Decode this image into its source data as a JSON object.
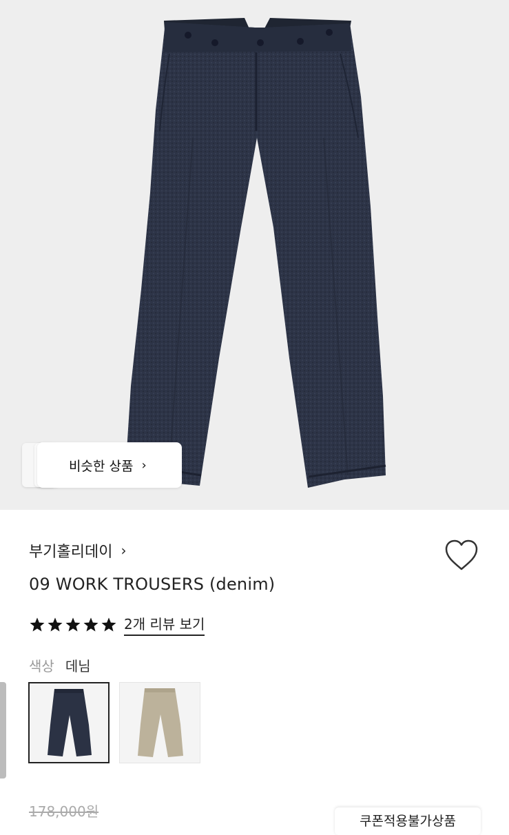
{
  "similar_button": {
    "label": "비슷한 상품",
    "chevron": "›"
  },
  "product": {
    "brand": "부기홀리데이",
    "brand_chevron": "›",
    "title": "09 WORK TROUSERS (denim)",
    "rating_stars": 5,
    "review_link": "2개 리뷰 보기",
    "color_label": "색상",
    "color_value": "데님",
    "price_original": "178,000원",
    "coupon_button": "쿠폰적용불가상품"
  },
  "swatches": [
    {
      "name": "denim",
      "color": "#2b3244",
      "selected": true
    },
    {
      "name": "beige",
      "color": "#bcb29b",
      "selected": false
    }
  ],
  "icons": {
    "heart": "heart-icon",
    "star": "star-icon",
    "chevron": "chevron-right-icon"
  },
  "colors": {
    "hero_bg": "#eeeeee",
    "denim": "#2b3244",
    "beige": "#bcb29b",
    "text": "#222222",
    "muted": "#999999"
  }
}
